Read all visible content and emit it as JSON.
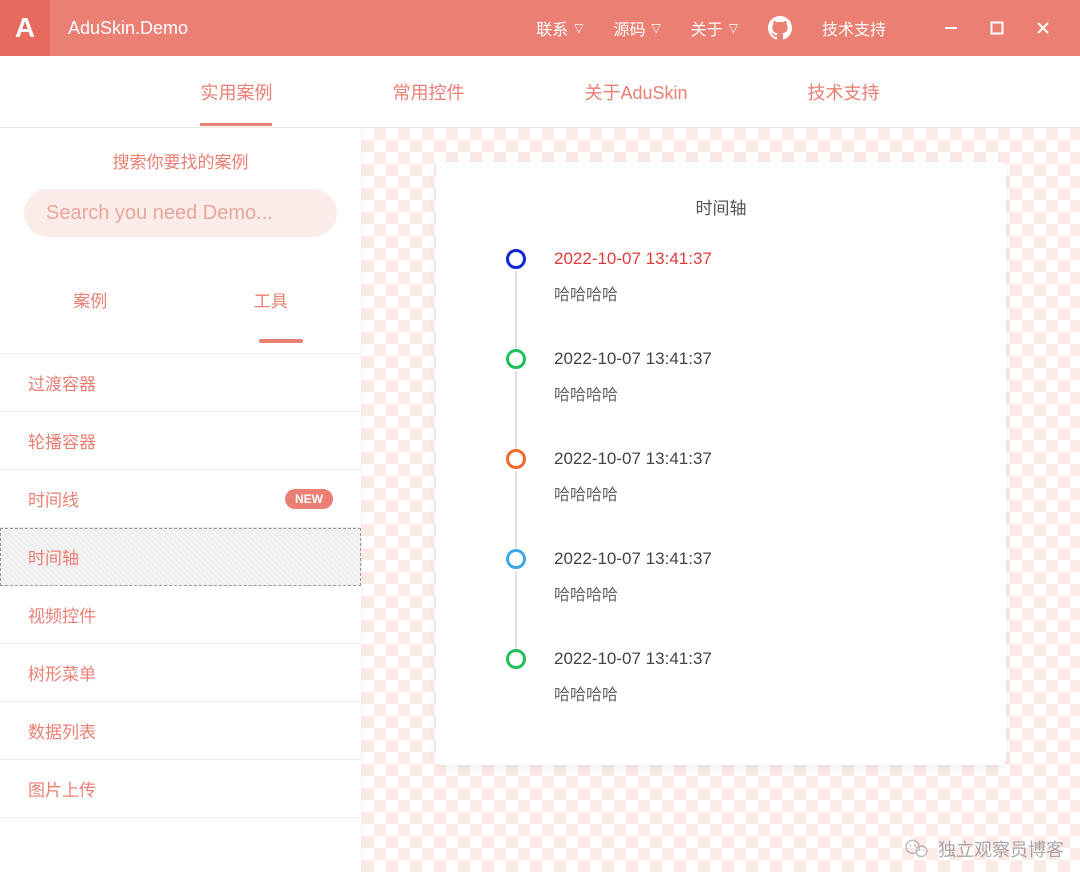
{
  "titlebar": {
    "logo_letter": "A",
    "title": "AduSkin.Demo",
    "menu": {
      "contact": "联系",
      "source": "源码",
      "about": "关于",
      "support": "技术支持"
    }
  },
  "main_tabs": [
    "实用案例",
    "常用控件",
    "关于AduSkin",
    "技术支持"
  ],
  "main_tab_active": 0,
  "sidebar": {
    "search_label": "搜索你要找的案例",
    "search_placeholder": "Search you need Demo...",
    "sub_tabs": [
      "案例",
      "工具"
    ],
    "sub_tab_active": 0,
    "items": [
      {
        "label": "过渡容器"
      },
      {
        "label": "轮播容器"
      },
      {
        "label": "时间线",
        "badge": "NEW"
      },
      {
        "label": "时间轴",
        "selected": true
      },
      {
        "label": "视频控件"
      },
      {
        "label": "树形菜单"
      },
      {
        "label": "数据列表"
      },
      {
        "label": "图片上传"
      }
    ]
  },
  "content": {
    "card_title": "时间轴",
    "timeline": [
      {
        "time": "2022-10-07 13:41:37",
        "desc": "哈哈哈哈",
        "color": "#1126D6",
        "highlight": true
      },
      {
        "time": "2022-10-07 13:41:37",
        "desc": "哈哈哈哈",
        "color": "#1FBF5C"
      },
      {
        "time": "2022-10-07 13:41:37",
        "desc": "哈哈哈哈",
        "color": "#F0682A"
      },
      {
        "time": "2022-10-07 13:41:37",
        "desc": "哈哈哈哈",
        "color": "#3FA7E8"
      },
      {
        "time": "2022-10-07 13:41:37",
        "desc": "哈哈哈哈",
        "color": "#1FBF5C"
      }
    ]
  },
  "watermark": "独立观察员博客"
}
